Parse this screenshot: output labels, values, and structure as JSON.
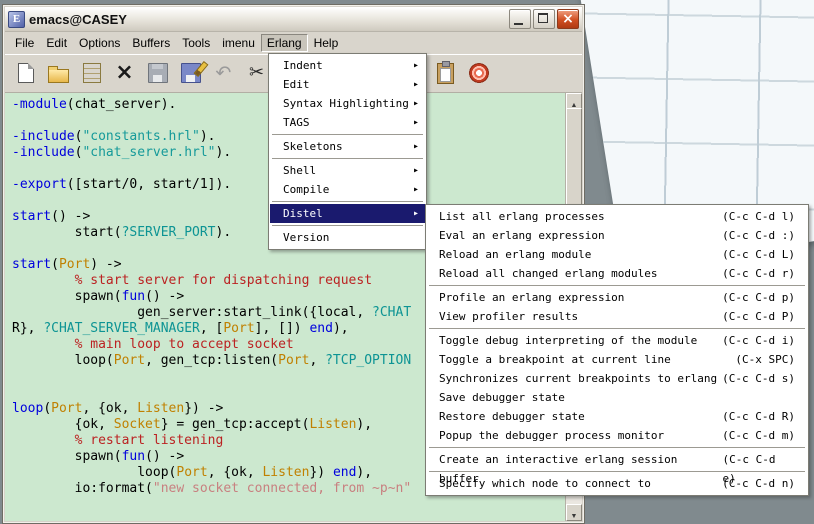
{
  "window": {
    "title": "emacs@CASEY",
    "controls": [
      "minimize",
      "maximize",
      "close"
    ]
  },
  "menubar": {
    "items": [
      "File",
      "Edit",
      "Options",
      "Buffers",
      "Tools",
      "imenu",
      "Erlang",
      "Help"
    ],
    "active": "Erlang"
  },
  "toolbar": {
    "left_icons": [
      "new-file",
      "open-folder",
      "dired",
      "close-buffer",
      "save",
      "save-as",
      "undo",
      "cut"
    ],
    "right_icons": [
      "paste",
      "preferences"
    ]
  },
  "erlang_menu": {
    "items": [
      {
        "label": "Indent",
        "submenu": true
      },
      {
        "label": "Edit",
        "submenu": true
      },
      {
        "label": "Syntax Highlighting",
        "submenu": true
      },
      {
        "label": "TAGS",
        "submenu": true
      },
      {
        "separator": true
      },
      {
        "label": "Skeletons",
        "submenu": true
      },
      {
        "separator": true
      },
      {
        "label": "Shell",
        "submenu": true
      },
      {
        "label": "Compile",
        "submenu": true
      },
      {
        "separator": true
      },
      {
        "label": "Distel",
        "submenu": true,
        "highlighted": true
      },
      {
        "separator": true
      },
      {
        "label": "Version",
        "submenu": false
      }
    ]
  },
  "distel_menu": {
    "items": [
      {
        "label": "List all erlang processes",
        "binding": "(C-c C-d l)"
      },
      {
        "label": "Eval an erlang expression",
        "binding": "(C-c C-d :)"
      },
      {
        "label": "Reload an erlang module",
        "binding": "(C-c C-d L)"
      },
      {
        "label": "Reload all changed erlang modules",
        "binding": "(C-c C-d r)"
      },
      {
        "separator": true
      },
      {
        "label": "Profile an erlang expression",
        "binding": "(C-c C-d p)"
      },
      {
        "label": "View profiler results",
        "binding": "(C-c C-d P)"
      },
      {
        "separator": true
      },
      {
        "label": "Toggle debug interpreting of the module",
        "binding": "(C-c C-d i)"
      },
      {
        "label": "Toggle a breakpoint at current line",
        "binding": "(C-x SPC)"
      },
      {
        "label": "Synchronizes current breakpoints to erlang",
        "binding": "(C-c C-d s)"
      },
      {
        "label": "Save debugger state",
        "binding": ""
      },
      {
        "label": "Restore debugger state",
        "binding": "(C-c C-d R)"
      },
      {
        "label": "Popup the debugger process monitor",
        "binding": "(C-c C-d m)"
      },
      {
        "separator": true
      },
      {
        "label": "Create an interactive erlang session buffer",
        "binding": "(C-c C-d e)"
      },
      {
        "separator": true
      },
      {
        "label": "Specify which node to connect to",
        "binding": "(C-c C-d n)"
      }
    ]
  },
  "editor": {
    "lines": [
      [
        [
          "kw",
          "-module"
        ],
        [
          "pl",
          "(chat_server)."
        ]
      ],
      [],
      [
        [
          "kw",
          "-include"
        ],
        [
          "pl",
          "("
        ],
        [
          "is",
          "\"constants.hrl\""
        ],
        [
          "pl",
          ")."
        ]
      ],
      [
        [
          "kw",
          "-include"
        ],
        [
          "pl",
          "("
        ],
        [
          "is",
          "\"chat_server.hrl\""
        ],
        [
          "pl",
          ")."
        ]
      ],
      [],
      [
        [
          "kw",
          "-export"
        ],
        [
          "pl",
          "([start/0, start/1])."
        ]
      ],
      [],
      [
        [
          "fn",
          "start"
        ],
        [
          "pl",
          "() ->"
        ]
      ],
      [
        [
          "pl",
          "        start("
        ],
        [
          "ma",
          "?SERVER_PORT"
        ],
        [
          "pl",
          ")."
        ]
      ],
      [],
      [
        [
          "fn",
          "start"
        ],
        [
          "pl",
          "("
        ],
        [
          "va",
          "Port"
        ],
        [
          "pl",
          ") ->"
        ]
      ],
      [
        [
          "co",
          "        % start server for dispatching request"
        ]
      ],
      [
        [
          "pl",
          "        spawn("
        ],
        [
          "kw",
          "fun"
        ],
        [
          "pl",
          "() ->"
        ]
      ],
      [
        [
          "pl",
          "                gen_server:start_link({local, "
        ],
        [
          "ma",
          "?CHAT"
        ]
      ],
      [
        [
          "pl",
          "R}, "
        ],
        [
          "ma",
          "?CHAT_SERVER_MANAGER"
        ],
        [
          "pl",
          ", ["
        ],
        [
          "va",
          "Port"
        ],
        [
          "pl",
          "], []) "
        ],
        [
          "kw",
          "end"
        ],
        [
          "pl",
          "),"
        ]
      ],
      [
        [
          "co",
          "        % main loop to accept socket"
        ]
      ],
      [
        [
          "pl",
          "        loop("
        ],
        [
          "va",
          "Port"
        ],
        [
          "pl",
          ", gen_tcp:listen("
        ],
        [
          "va",
          "Port"
        ],
        [
          "pl",
          ", "
        ],
        [
          "ma",
          "?TCP_OPTION"
        ]
      ],
      [],
      [],
      [
        [
          "fn",
          "loop"
        ],
        [
          "pl",
          "("
        ],
        [
          "va",
          "Port"
        ],
        [
          "pl",
          ", {ok, "
        ],
        [
          "va",
          "Listen"
        ],
        [
          "pl",
          "}) ->"
        ]
      ],
      [
        [
          "pl",
          "        {ok, "
        ],
        [
          "va",
          "Socket"
        ],
        [
          "pl",
          "} = gen_tcp:accept("
        ],
        [
          "va",
          "Listen"
        ],
        [
          "pl",
          "),"
        ]
      ],
      [
        [
          "co",
          "        % restart listening"
        ]
      ],
      [
        [
          "pl",
          "        spawn("
        ],
        [
          "kw",
          "fun"
        ],
        [
          "pl",
          "() ->"
        ]
      ],
      [
        [
          "pl",
          "                loop("
        ],
        [
          "va",
          "Port"
        ],
        [
          "pl",
          ", {ok, "
        ],
        [
          "va",
          "Listen"
        ],
        [
          "pl",
          "}) "
        ],
        [
          "kw",
          "end"
        ],
        [
          "pl",
          "),"
        ]
      ],
      [
        [
          "pl",
          "        io:format("
        ],
        [
          "st",
          "\"new socket connected, from ~p~n\""
        ]
      ]
    ]
  },
  "colors": {
    "editor_bg": "#cce8cf",
    "menu_highlight": "#1a1a6e",
    "close_button": "#c8432a",
    "keyword": "#0000dd",
    "function_name": "#0000dd",
    "string": "#c88080",
    "include_string": "#169a9a",
    "macro": "#0d9494",
    "variable": "#c08000",
    "comment": "#bb2222"
  }
}
